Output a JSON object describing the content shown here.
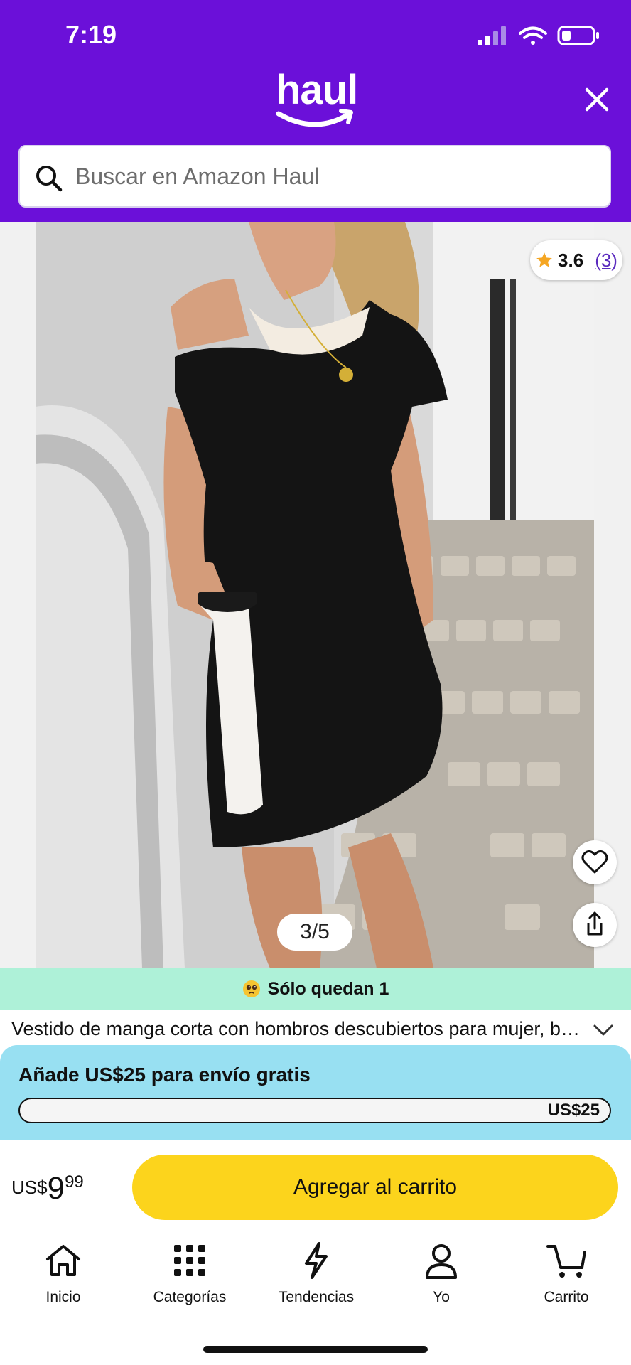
{
  "status_bar": {
    "time": "7:19"
  },
  "header": {
    "logo_text": "haul",
    "colors": {
      "brand": "#6b10d9"
    }
  },
  "search": {
    "placeholder": "Buscar en Amazon Haul"
  },
  "product": {
    "rating": {
      "value": "3.6",
      "count": "(3)"
    },
    "image_position": "3/5",
    "stock_message": "Sólo quedan 1",
    "title": "Vestido de manga corta con hombros descubiertos para mujer, blo..."
  },
  "shipping": {
    "message": "Añade US$25 para envío gratis",
    "progress_label": "US$25",
    "progress_fraction": 0.0
  },
  "price": {
    "currency": "US$",
    "whole": "9",
    "cents": "99"
  },
  "actions": {
    "add_to_cart": "Agregar al carrito"
  },
  "nav": {
    "items": [
      {
        "label": "Inicio",
        "icon": "home-icon"
      },
      {
        "label": "Categorías",
        "icon": "grid-icon"
      },
      {
        "label": "Tendencias",
        "icon": "lightning-icon"
      },
      {
        "label": "Yo",
        "icon": "person-icon"
      },
      {
        "label": "Carrito",
        "icon": "cart-icon"
      }
    ]
  }
}
